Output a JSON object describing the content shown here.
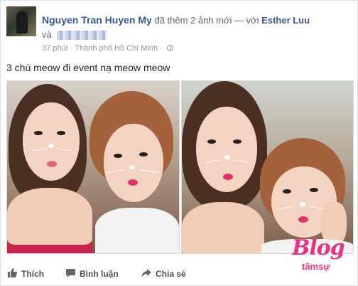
{
  "post": {
    "author": "Nguyen Tran Huyen My",
    "verb": "đã thêm 2 ảnh mới — với",
    "tagged_friend": "Esther Luu",
    "and_word": "và",
    "timestamp": "37 phút",
    "separator": "·",
    "location": "Thành phố Hồ Chí Minh",
    "text": "3 chú meow đi event nạ meow meow"
  },
  "photos": [
    {
      "alt": "photo-1"
    },
    {
      "alt": "photo-2"
    }
  ],
  "actions": {
    "like": "Thích",
    "comment": "Bình luận",
    "share": "Chia sẻ"
  },
  "watermark": {
    "brand": "Blog",
    "sub": "tâmsự"
  },
  "colors": {
    "link": "#365899",
    "meta": "#90949c",
    "brand_pink": "#e8327f"
  }
}
